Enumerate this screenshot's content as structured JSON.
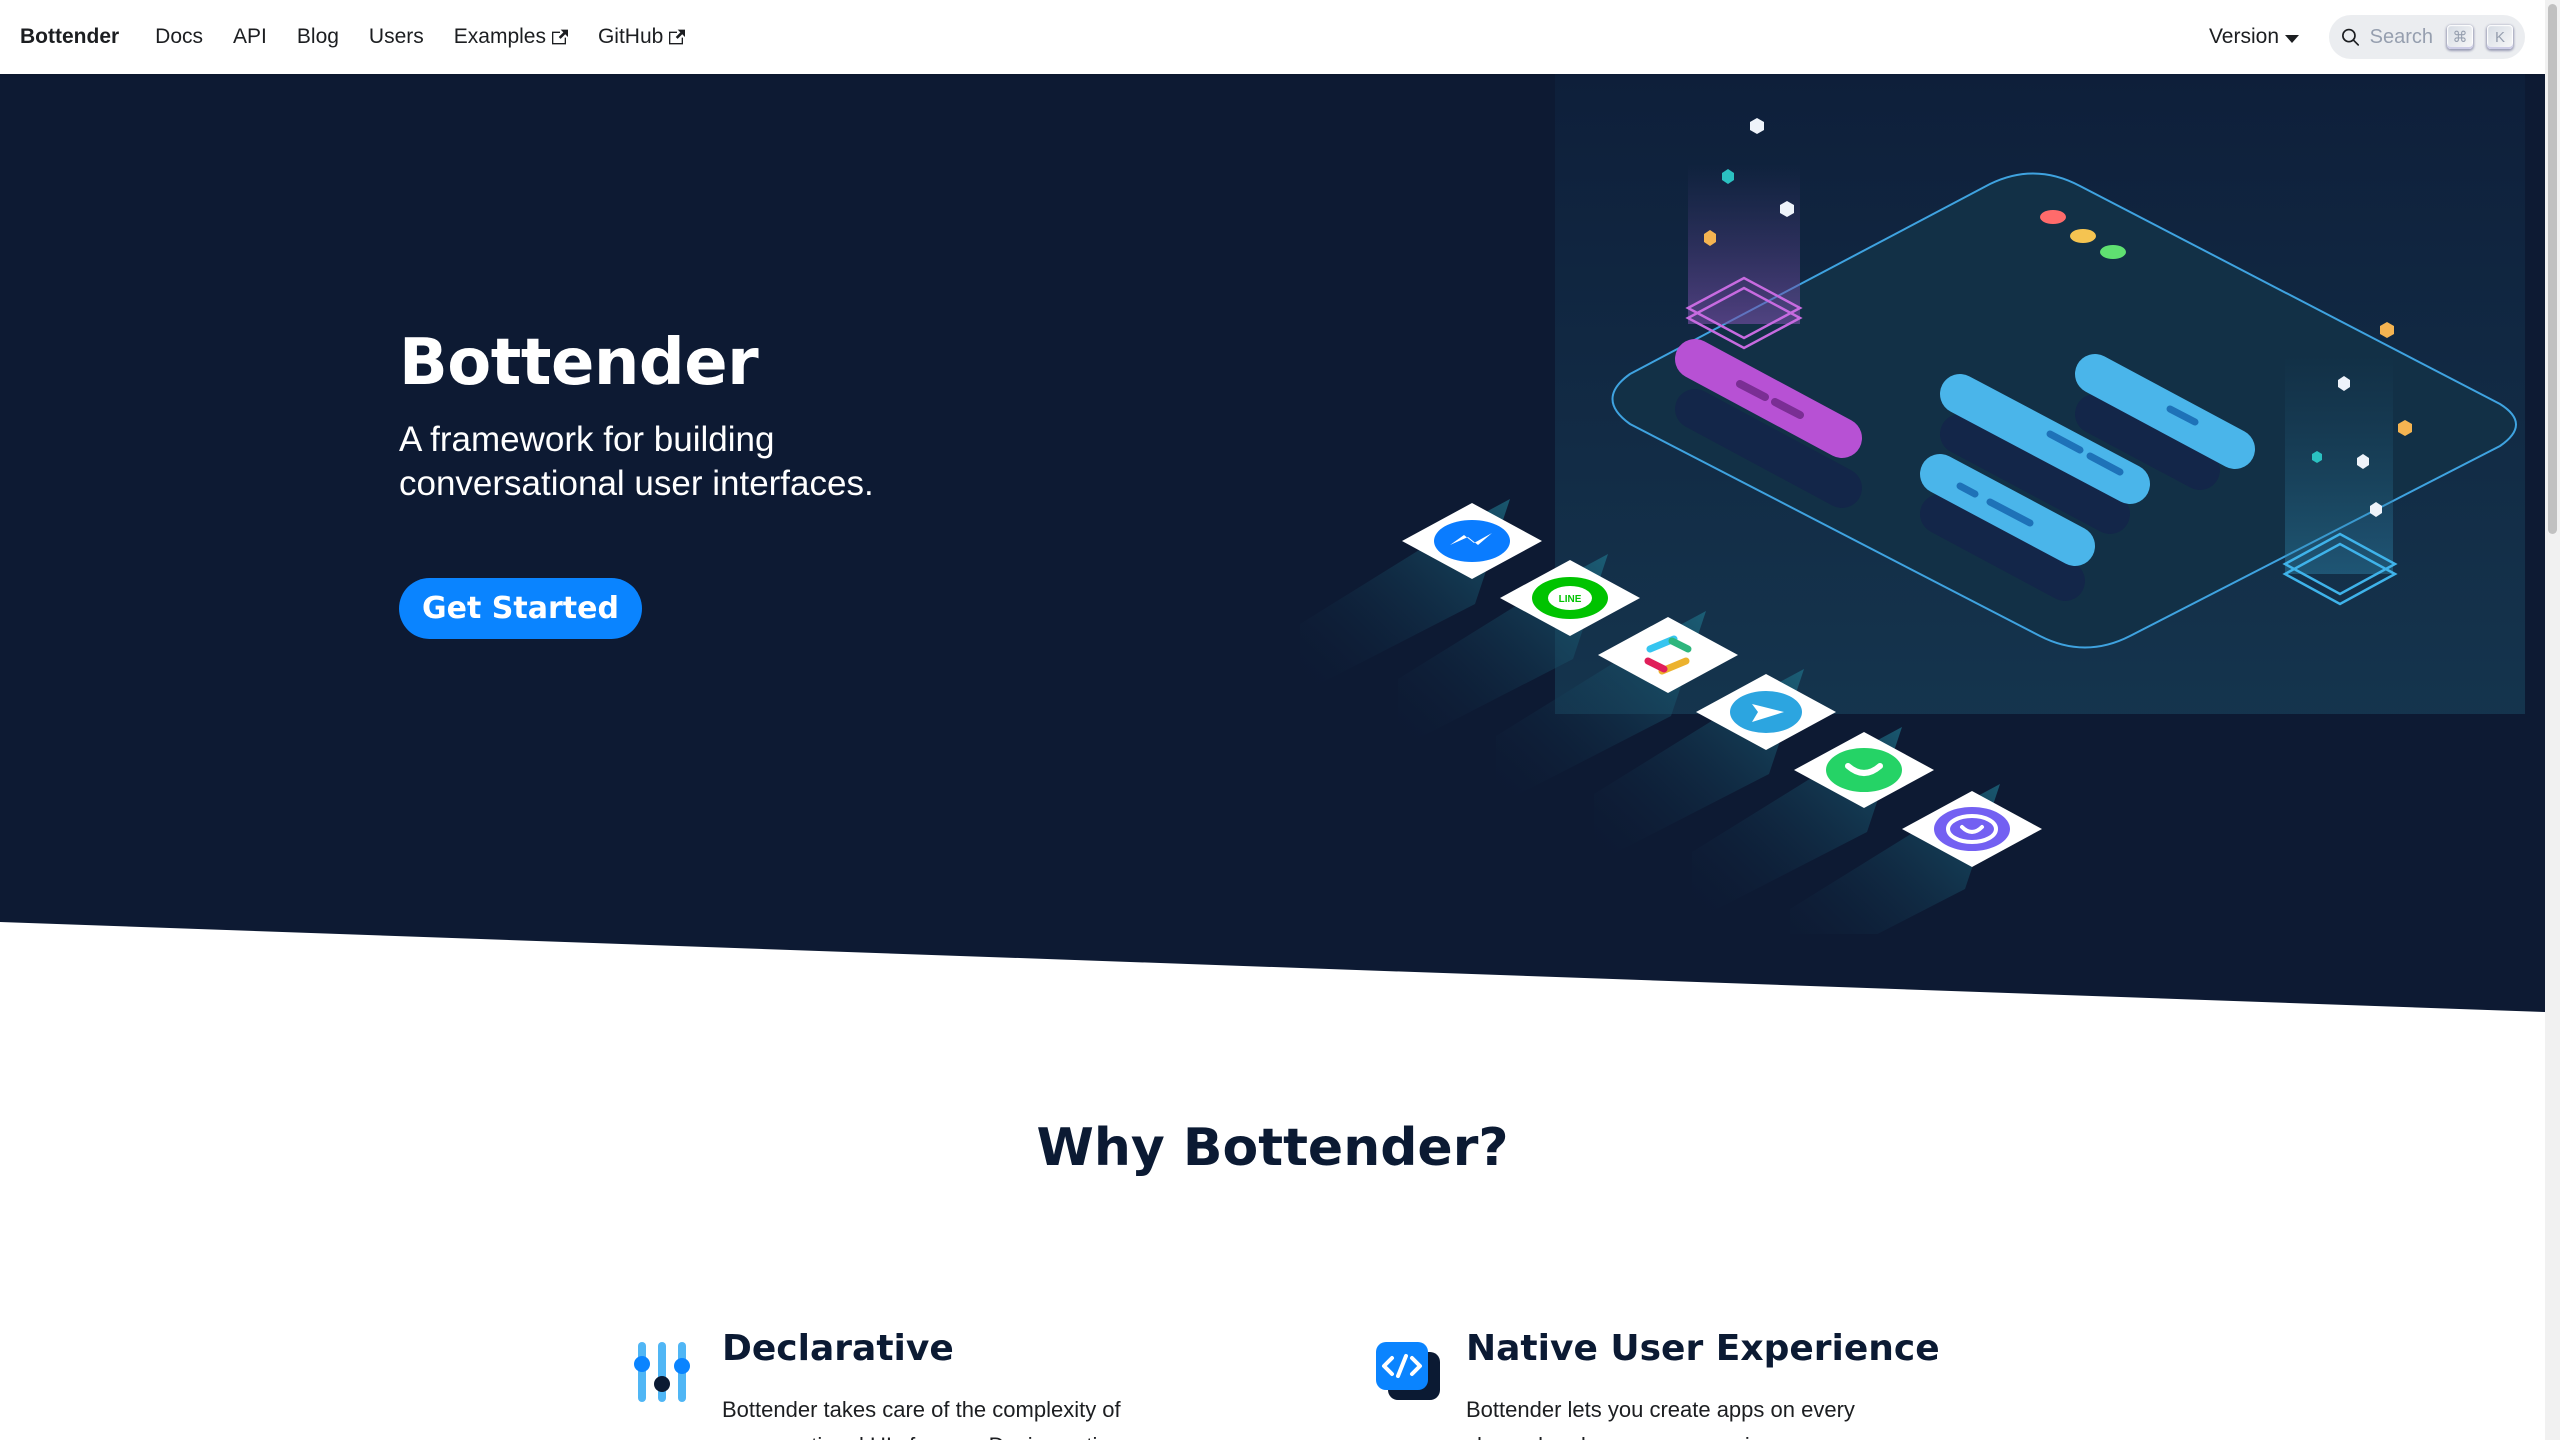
{
  "navbar": {
    "brand": "Bottender",
    "links": [
      "Docs",
      "API",
      "Blog",
      "Users"
    ],
    "external_links": [
      "Examples",
      "GitHub"
    ],
    "version_label": "Version",
    "search_placeholder": "Search",
    "search_keys": [
      "⌘",
      "K"
    ]
  },
  "hero": {
    "title": "Bottender",
    "subtitle": "A framework for building conversational user interfaces.",
    "cta_label": "Get Started",
    "platform_icons": [
      "messenger-icon",
      "line-icon",
      "slack-icon",
      "telegram-icon",
      "whatsapp-icon",
      "viber-icon"
    ]
  },
  "why": {
    "title": "Why Bottender?",
    "features": [
      {
        "title": "Declarative",
        "text": "Bottender takes care of the complexity of conversational UIs for you. Design actions",
        "icon": "sliders-icon"
      },
      {
        "title": "Native User Experience",
        "text": "Bottender lets you create apps on every channel and never compromise",
        "icon": "code-icon"
      }
    ]
  },
  "colors": {
    "hero_bg": "#0d1a33",
    "accent": "#0a84ff",
    "heading": "#0b1a33"
  }
}
